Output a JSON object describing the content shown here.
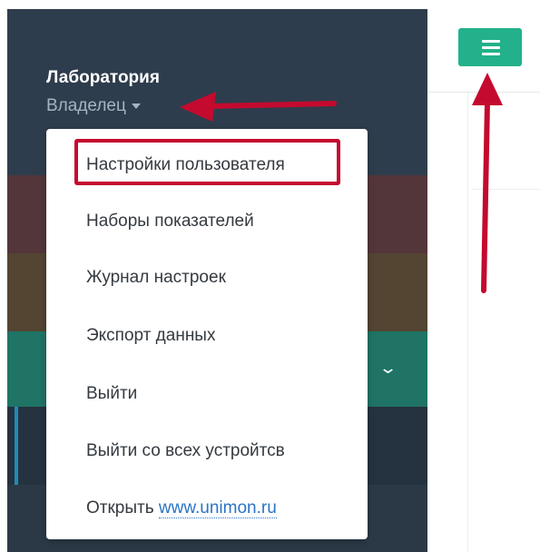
{
  "sidebar": {
    "title": "Лаборатория",
    "role": "Владелец"
  },
  "dropdown": {
    "items": [
      {
        "label": "Настройки пользователя"
      },
      {
        "label": "Наборы показателей"
      },
      {
        "label": "Журнал настроек"
      },
      {
        "label": "Экспорт данных"
      },
      {
        "label": "Выйти"
      },
      {
        "label": "Выйти со всех устройтсв"
      }
    ],
    "open_prefix": "Открыть",
    "open_link": "www.unimon.ru"
  },
  "icons": {
    "menu": "hamburger-icon",
    "role_caret": "caret-down-icon",
    "section_chevron": "chevron-down-icon"
  },
  "colors": {
    "accent": "#22b18a",
    "annotation": "#c40a2e",
    "link": "#2a74c6",
    "sidebar_bg": "#2f3e4f"
  }
}
